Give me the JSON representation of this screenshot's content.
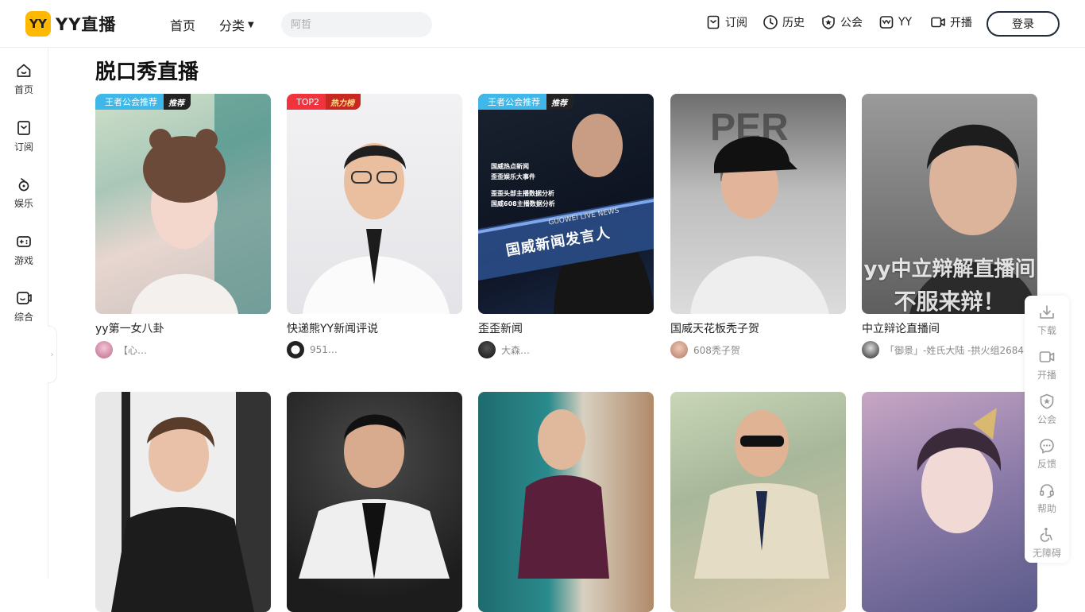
{
  "header": {
    "logo_badge": "YY",
    "logo_text": "YY直播",
    "nav_home": "首页",
    "nav_category": "分类",
    "search_placeholder": "阿哲",
    "subscribe": "订阅",
    "history": "历史",
    "guild": "公会",
    "yy": "YY",
    "broadcast": "开播",
    "login": "登录"
  },
  "sidebar": {
    "items": [
      {
        "label": "首页",
        "icon": "home-icon"
      },
      {
        "label": "订阅",
        "icon": "bookmark-icon"
      },
      {
        "label": "娱乐",
        "icon": "entertainment-icon"
      },
      {
        "label": "游戏",
        "icon": "gamepad-icon"
      },
      {
        "label": "综合",
        "icon": "general-icon"
      }
    ],
    "toggle": "›"
  },
  "section": {
    "title": "脱口秀直播"
  },
  "cards": [
    {
      "title": "yy第一女八卦",
      "user": "【心…",
      "badge1": "王者公会推荐",
      "badge2": "推荐",
      "badge_color": "#3fb7e8"
    },
    {
      "title": "快递熊YY新闻评说",
      "user": "951…",
      "badge1": "TOP2",
      "badge2": "热力榜",
      "badge_color": "#f0333d"
    },
    {
      "title": "歪歪新闻",
      "user": "大森…",
      "badge1": "王者公会推荐",
      "badge2": "推荐",
      "badge_color": "#3fb7e8",
      "poster_lines": [
        "国威热点新闻",
        "歪歪娱乐大事件",
        "歪歪头部主播数据分析",
        "国威608主播数据分析"
      ],
      "poster_en": "GUOWEI LIVE NEWS",
      "poster_banner": "国威新闻发言人"
    },
    {
      "title": "国威天花板秃子贺",
      "user": "608秃子贺"
    },
    {
      "title": "中立辩论直播间",
      "user": "「御景」-姓氏大陆 -拱火组2684",
      "overlay1": "yy中立辩解直播间",
      "overlay2": "不服来辩！"
    },
    {
      "title": "",
      "user": ""
    },
    {
      "title": "",
      "user": ""
    },
    {
      "title": "",
      "user": ""
    },
    {
      "title": "",
      "user": ""
    },
    {
      "title": "",
      "user": ""
    }
  ],
  "floatbar": {
    "items": [
      {
        "label": "下载",
        "icon": "download-icon"
      },
      {
        "label": "开播",
        "icon": "camera-icon"
      },
      {
        "label": "公会",
        "icon": "guild-icon"
      },
      {
        "label": "反馈",
        "icon": "feedback-icon"
      },
      {
        "label": "帮助",
        "icon": "headset-icon"
      },
      {
        "label": "无障碍",
        "icon": "accessibility-icon"
      }
    ]
  }
}
